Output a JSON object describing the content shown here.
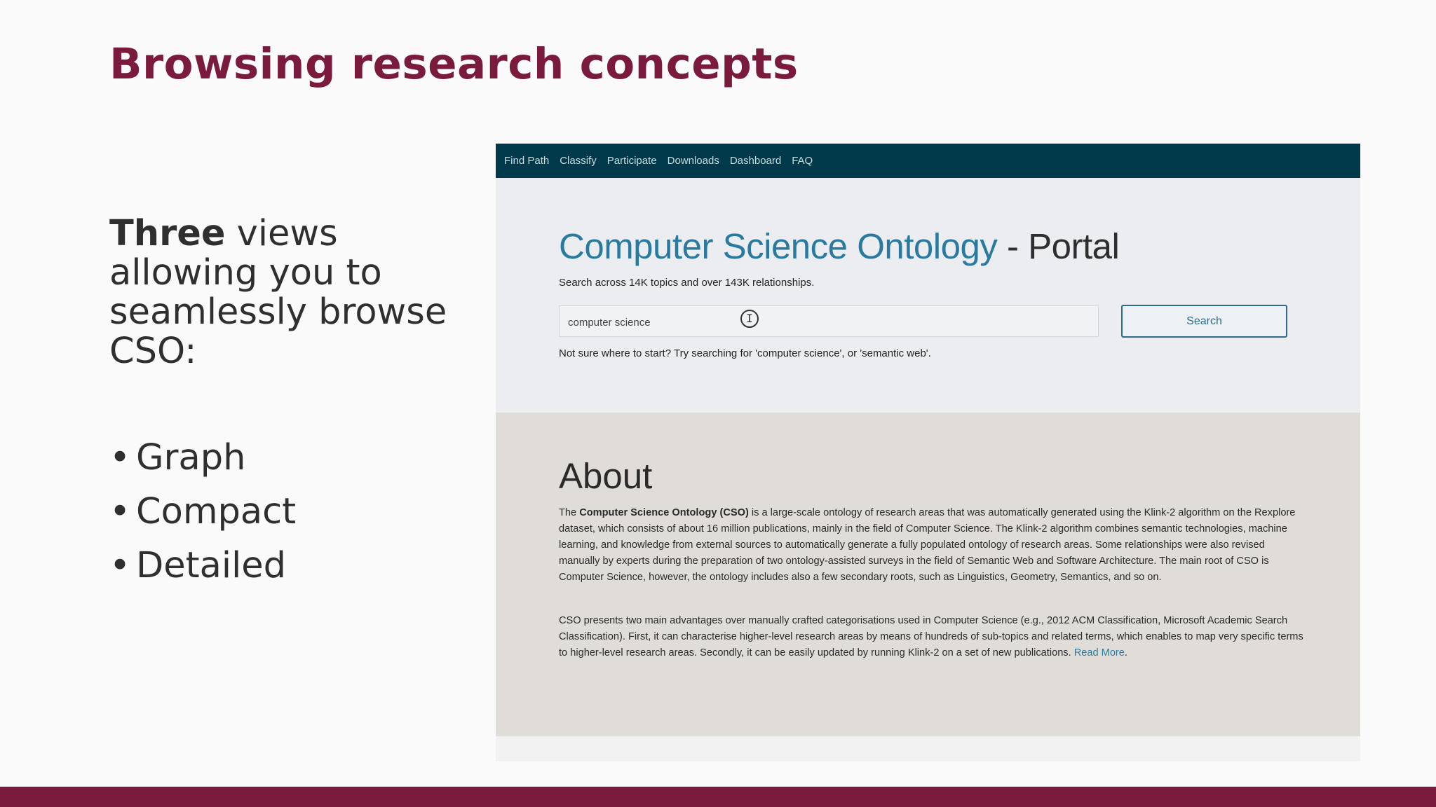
{
  "slide": {
    "title": "Browsing research concepts",
    "intro_bold": "Three",
    "intro_line1_rest": " views",
    "intro_line2": "allowing you to",
    "intro_line3": "seamlessly browse",
    "intro_line4": "CSO:",
    "bullet_glyph": "•",
    "views": [
      "Graph",
      "Compact",
      "Detailed"
    ]
  },
  "portal": {
    "nav": [
      "Find Path",
      "Classify",
      "Participate",
      "Downloads",
      "Dashboard",
      "FAQ"
    ],
    "heading_blue": "Computer Science Ontology",
    "heading_rest": " - Portal",
    "subtitle": "Search across 14K topics and over 143K relationships.",
    "search_value": "computer science",
    "search_button": "Search",
    "text_cursor_icon": "I",
    "hint": "Not sure where to start? Try searching for 'computer science', or 'semantic web'.",
    "about": {
      "heading": "About",
      "p1_start": "The ",
      "p1_bold": "Computer Science Ontology (CSO)",
      "p1_rest": " is a large-scale ontology of research areas that was automatically generated using the Klink-2 algorithm on the Rexplore dataset, which consists of about 16 million publications, mainly in the field of Computer Science. The Klink-2 algorithm combines semantic technologies, machine learning, and knowledge from external sources to automatically generate a fully populated ontology of research areas. Some relationships were also revised manually by experts during the preparation of two ontology-assisted surveys in the field of Semantic Web and Software Architecture. The main root of CSO is Computer Science, however, the ontology includes also a few secondary roots, such as Linguistics, Geometry, Semantics, and so on.",
      "p2": "CSO presents two main advantages over manually crafted categorisations used in Computer Science (e.g., 2012 ACM Classification, Microsoft Academic Search Classification). First, it can characterise higher-level research areas by means of hundreds of sub-topics and related terms, which enables to map very specific terms to higher-level research areas. Secondly, it can be easily updated by running Klink-2 on a set of new publications. ",
      "read_more": "Read More",
      "p2_end": "."
    }
  },
  "colors": {
    "accent": "#7a1a3d",
    "nav_background": "#003a4a",
    "link_blue": "#2a7aa0"
  }
}
